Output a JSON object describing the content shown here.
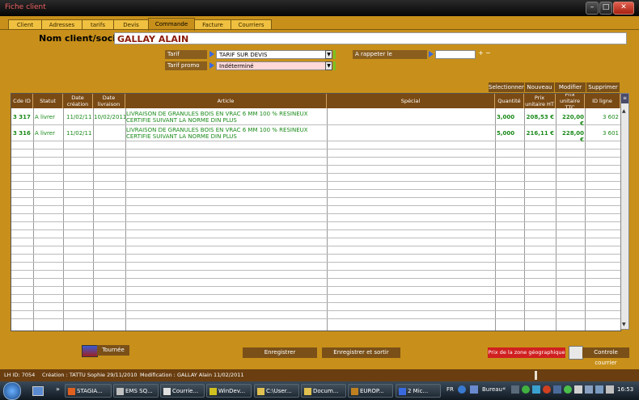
{
  "window": {
    "title": "Fiche client"
  },
  "tabs": [
    "Client",
    "Adresses",
    "tarifs",
    "Devis",
    "Commande",
    "Facture",
    "Courriers"
  ],
  "client": {
    "label": "Nom client/société",
    "name": "GALLAY ALAIN"
  },
  "fields": {
    "tarif_label": "Tarif",
    "tarif_value": "TARIF SUR DEVIS",
    "promo_label": "Tarif promo",
    "promo_value": "Indéterminé",
    "rappel_label": "A rappeter le",
    "rappel_value": ""
  },
  "actions": {
    "select": "Selectionner",
    "new": "Nouveau",
    "modify": "Modifier",
    "delete": "Supprimer"
  },
  "table": {
    "headers": [
      "Cde ID",
      "Statut",
      "Date création",
      "Date livraison",
      "Article",
      "Spécial",
      "Quantité",
      "Prix unitaire HT",
      "Prix unitaire TTC",
      "ID ligne"
    ],
    "rows": [
      [
        "3 317",
        "A livrer",
        "11/02/11",
        "10/02/2011",
        "LIVRAISON DE GRANULES BOIS EN VRAC 6 MM 100 % RESINEUX CERTIFIE SUIVANT LA  NORME DIN PLUS",
        "",
        "3,000",
        "208,53 €",
        "220,00 €",
        "3 602"
      ],
      [
        "3 316",
        "A livrer",
        "11/02/11",
        "",
        "LIVRAISON DE GRANULES BOIS EN VRAC 6 MM 100 % RESINEUX CERTIFIE SUIVANT LA  NORME DIN PLUS",
        "",
        "5,000",
        "216,11 €",
        "228,00 €",
        "3 601"
      ]
    ]
  },
  "buttons": {
    "tournee": "Tournée",
    "save": "Enregistrer",
    "save_exit": "Enregistrer et sortir",
    "zone_price": "Prix de la zone géographique",
    "mail_control": "Controle courrier"
  },
  "status": {
    "lh": "LH  ID: 7054",
    "created": "Création : TATTU Sophie 29/11/2010",
    "modified": "Modification : GALLAY Alain  11/02/2011"
  },
  "taskbar": {
    "items": [
      "STAGIA...",
      "EMS SQ...",
      "Courrie...",
      "WinDev...",
      "C:\\User...",
      "Docum...",
      "EUROP...",
      "2 Mic..."
    ],
    "lang": "FR",
    "location": "Bureau",
    "time": "16:53"
  },
  "colors": {
    "accent": "#c8901a",
    "header": "#7a4a14",
    "rowtext": "#1a8a1a",
    "zone_button": "#d02020"
  }
}
